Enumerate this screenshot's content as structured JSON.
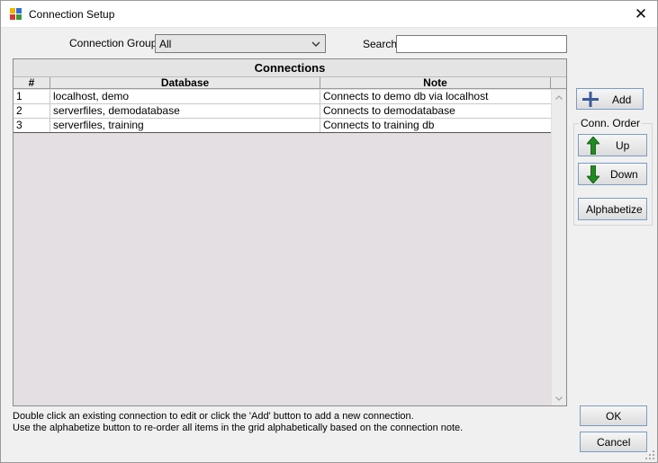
{
  "window": {
    "title": "Connection Setup"
  },
  "filters": {
    "groups_label": "Connection Groups",
    "groups_value": "All",
    "search_label": "Search",
    "search_value": ""
  },
  "grid": {
    "title": "Connections",
    "columns": [
      "#",
      "Database",
      "Note"
    ],
    "rows": [
      {
        "num": "1",
        "database": "localhost, demo",
        "note": "Connects to demo db via localhost"
      },
      {
        "num": "2",
        "database": "serverfiles, demodatabase",
        "note": "Connects to demodatabase"
      },
      {
        "num": "3",
        "database": "serverfiles, training",
        "note": "Connects to training db"
      }
    ]
  },
  "actions": {
    "add_label": "Add",
    "order_group_label": "Conn. Order",
    "up_label": "Up",
    "down_label": "Down",
    "alphabetize_label": "Alphabetize",
    "ok_label": "OK",
    "cancel_label": "Cancel"
  },
  "help": {
    "line1": "Double click an existing connection to edit or click the 'Add' button to add a new connection.",
    "line2": "Use the alphabetize button to re-order all items in the grid alphabetically based on the connection note."
  },
  "icons": {
    "app": "app-grid-icon",
    "close": "close-icon",
    "add": "plus-icon",
    "up": "green-up-arrow-icon",
    "down": "green-down-arrow-icon"
  },
  "colors": {
    "plus": "#3a5a9a",
    "arrows": "#1f8c1f",
    "button_border": "#7a9cc4"
  }
}
